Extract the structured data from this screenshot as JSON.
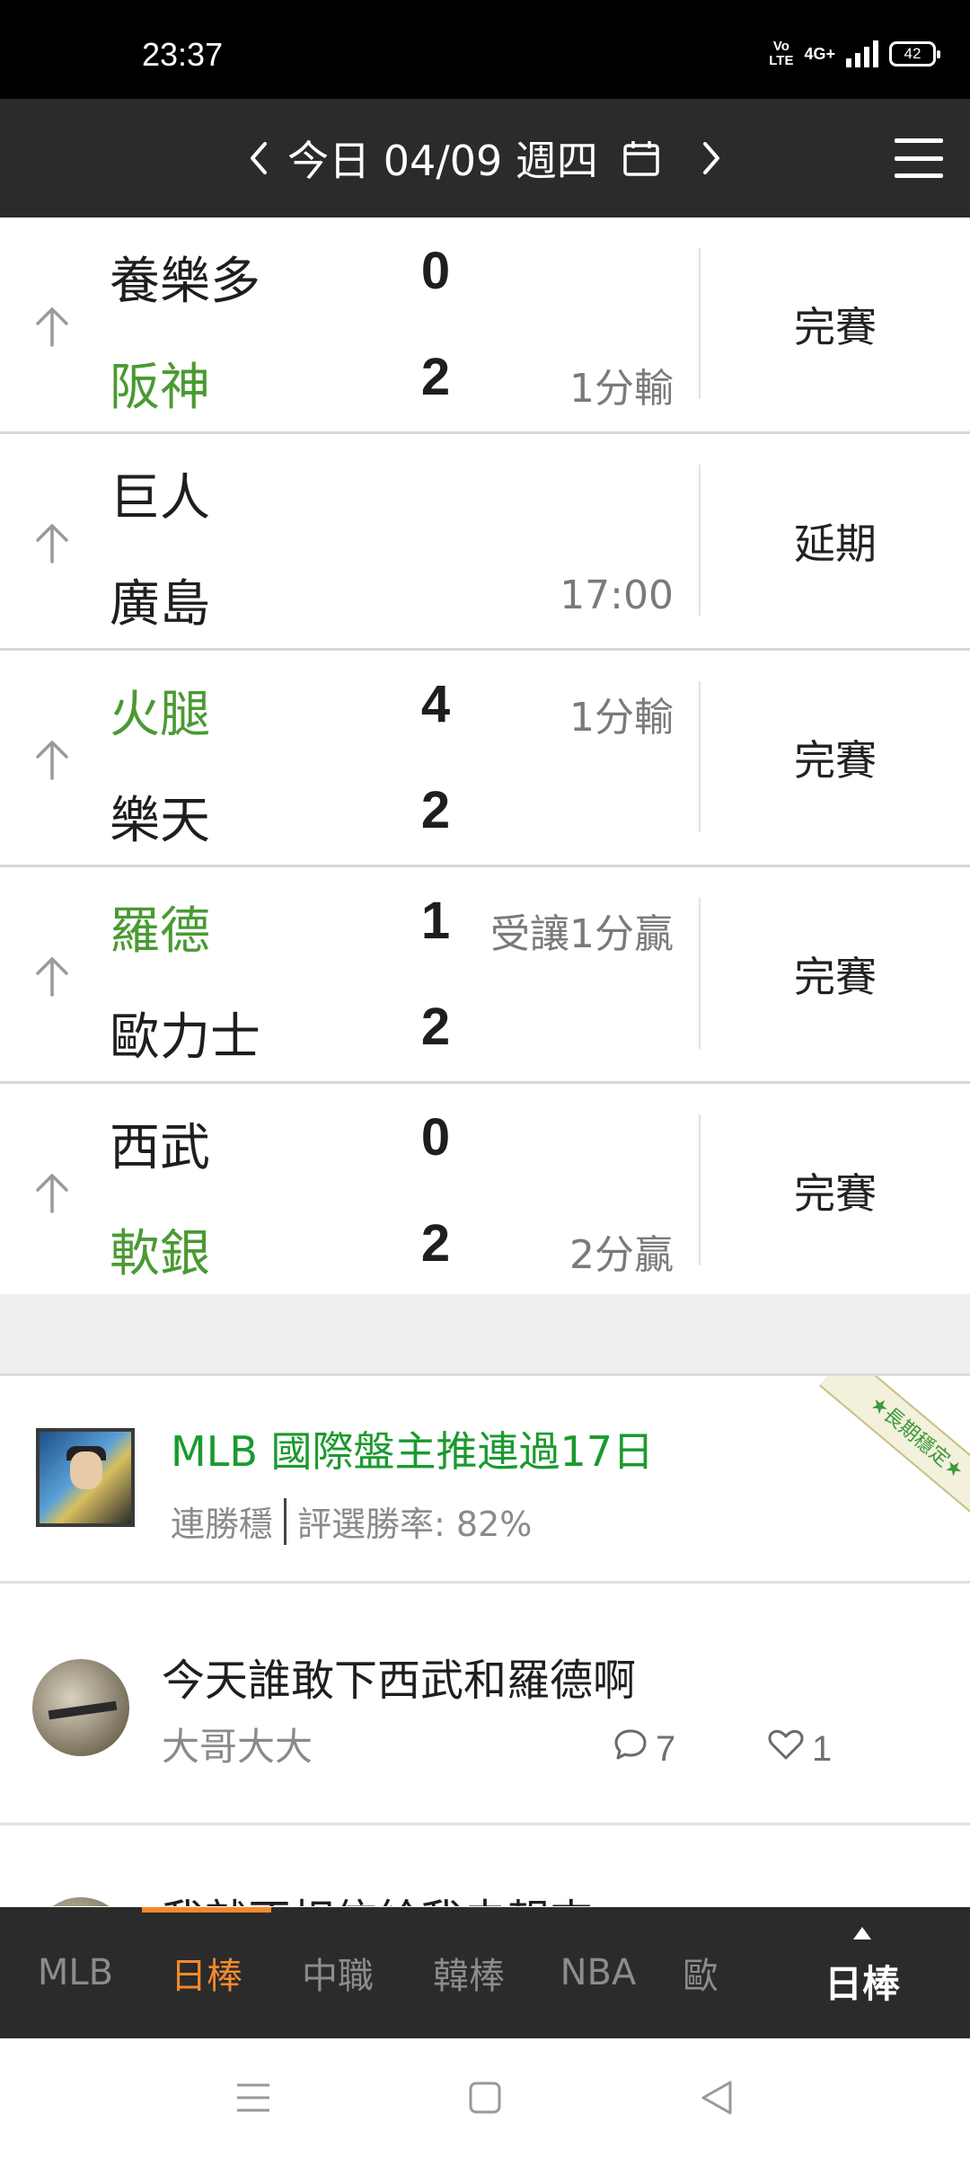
{
  "status_bar": {
    "time": "23:37",
    "volte": "Vo LTE",
    "network": "4G+",
    "battery": "42"
  },
  "header": {
    "date_label": "今日 04/09 週四",
    "prev_icon": "chevron-left-icon",
    "next_icon": "chevron-right-icon",
    "calendar_icon": "calendar-icon",
    "menu_icon": "hamburger-menu-icon"
  },
  "games": [
    {
      "away": {
        "name": "養樂多",
        "score": "0",
        "winner": false,
        "note": ""
      },
      "home": {
        "name": "阪神",
        "score": "2",
        "winner": true,
        "note": "1分輸"
      },
      "status": "完賽"
    },
    {
      "away": {
        "name": "巨人",
        "score": "",
        "winner": false,
        "note": ""
      },
      "home": {
        "name": "廣島",
        "score": "",
        "winner": false,
        "note": "17:00"
      },
      "status": "延期"
    },
    {
      "away": {
        "name": "火腿",
        "score": "4",
        "winner": true,
        "note": "1分輸"
      },
      "home": {
        "name": "樂天",
        "score": "2",
        "winner": false,
        "note": ""
      },
      "status": "完賽"
    },
    {
      "away": {
        "name": "羅德",
        "score": "1",
        "winner": true,
        "note": "受讓1分贏"
      },
      "home": {
        "name": "歐力士",
        "score": "2",
        "winner": false,
        "note": ""
      },
      "status": "完賽"
    },
    {
      "away": {
        "name": "西武",
        "score": "0",
        "winner": false,
        "note": ""
      },
      "home": {
        "name": "軟銀",
        "score": "2",
        "winner": true,
        "note": "2分贏"
      },
      "status": "完賽"
    }
  ],
  "promo": {
    "title": "MLB 國際盤主推連過17日",
    "tag": "連勝穩",
    "rate": "評選勝率: 82%",
    "ribbon": "★長期穩定★"
  },
  "posts": [
    {
      "title": "今天誰敢下西武和羅德啊",
      "author": "大哥大大",
      "comments": "7",
      "likes": "1"
    },
    {
      "title": "我就不相信給我去報來",
      "author": "",
      "comments": "",
      "likes": ""
    }
  ],
  "tabs": {
    "items": [
      "MLB",
      "日棒",
      "中職",
      "韓棒",
      "NBA",
      "歐"
    ],
    "active_index": 1,
    "current": "日棒"
  },
  "colors": {
    "winner": "#4a9a32",
    "accent": "#f28a2e",
    "promo_title": "#1a9a2e",
    "bar_bg": "#2b2b2b"
  }
}
